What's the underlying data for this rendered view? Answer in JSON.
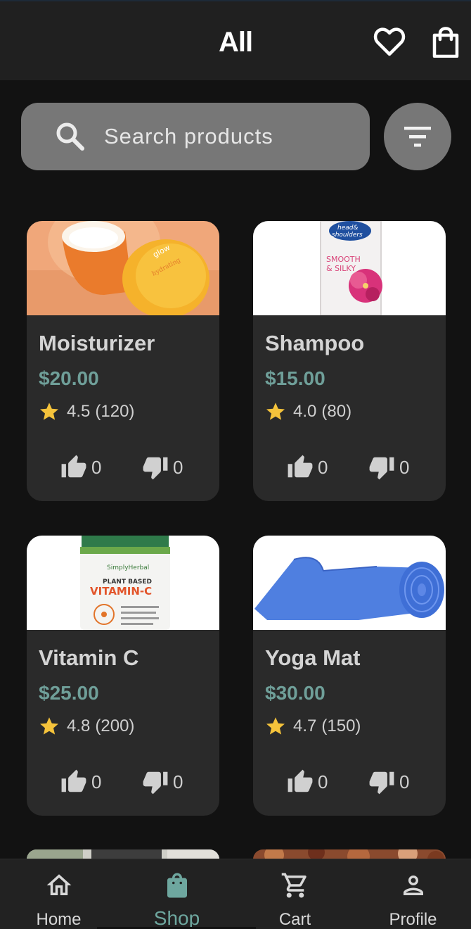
{
  "header": {
    "title": "All",
    "icons": [
      "heart-outline-icon",
      "shopping-bag-icon"
    ]
  },
  "search": {
    "placeholder": "Search products",
    "value": "",
    "icons": [
      "search-icon",
      "filter-icon"
    ]
  },
  "colors": {
    "background": "#121212",
    "card": "#2a2a2a",
    "accent": "#6f9f99",
    "star": "#f5c33b",
    "search_field": "#777777"
  },
  "products": [
    {
      "name": "Moisturizer",
      "price": "$20.00",
      "rating": "4.5",
      "reviews": "(120)",
      "likes": "0",
      "dislikes": "0",
      "image": "moisturizer-jar-photo"
    },
    {
      "name": "Shampoo",
      "price": "$15.00",
      "rating": "4.0",
      "reviews": "(80)",
      "likes": "0",
      "dislikes": "0",
      "image": "shampoo-bottle-photo"
    },
    {
      "name": "Vitamin C",
      "price": "$25.00",
      "rating": "4.8",
      "reviews": "(200)",
      "likes": "0",
      "dislikes": "0",
      "image": "vitamin-c-bottle-photo"
    },
    {
      "name": "Yoga Mat",
      "price": "$30.00",
      "rating": "4.7",
      "reviews": "(150)",
      "likes": "0",
      "dislikes": "0",
      "image": "yoga-mat-photo"
    }
  ],
  "bottom_nav": {
    "active": "Shop",
    "items": [
      {
        "label": "Home",
        "icon": "home-icon"
      },
      {
        "label": "Shop",
        "icon": "shopping-bag-icon"
      },
      {
        "label": "Cart",
        "icon": "cart-icon"
      },
      {
        "label": "Profile",
        "icon": "person-icon"
      }
    ]
  }
}
